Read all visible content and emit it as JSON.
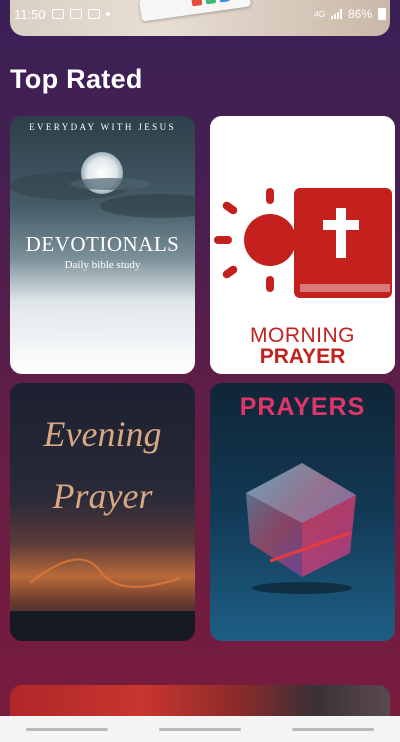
{
  "status": {
    "time": "11:50",
    "network": "4G",
    "battery": "86%"
  },
  "section": {
    "title": "Top Rated"
  },
  "cards": [
    {
      "overline": "EVERYDAY WITH JESUS",
      "title": "DEVOTIONALS",
      "subtitle": "Daily bible study"
    },
    {
      "line1": "MORNING",
      "line2": "PRAYER"
    },
    {
      "line1": "Evening",
      "line2": "Prayer"
    },
    {
      "title": "PRAYERS"
    }
  ],
  "colors": {
    "bg_top": "#3a2056",
    "bg_bottom": "#7a1c3c",
    "morning_red": "#c4211e",
    "prayers_pink": "#e0356a"
  },
  "icons": [
    "gallery-icon",
    "sim-icon",
    "cast-icon",
    "signal-icon",
    "battery-icon",
    "sun-icon",
    "bible-cross-icon"
  ]
}
